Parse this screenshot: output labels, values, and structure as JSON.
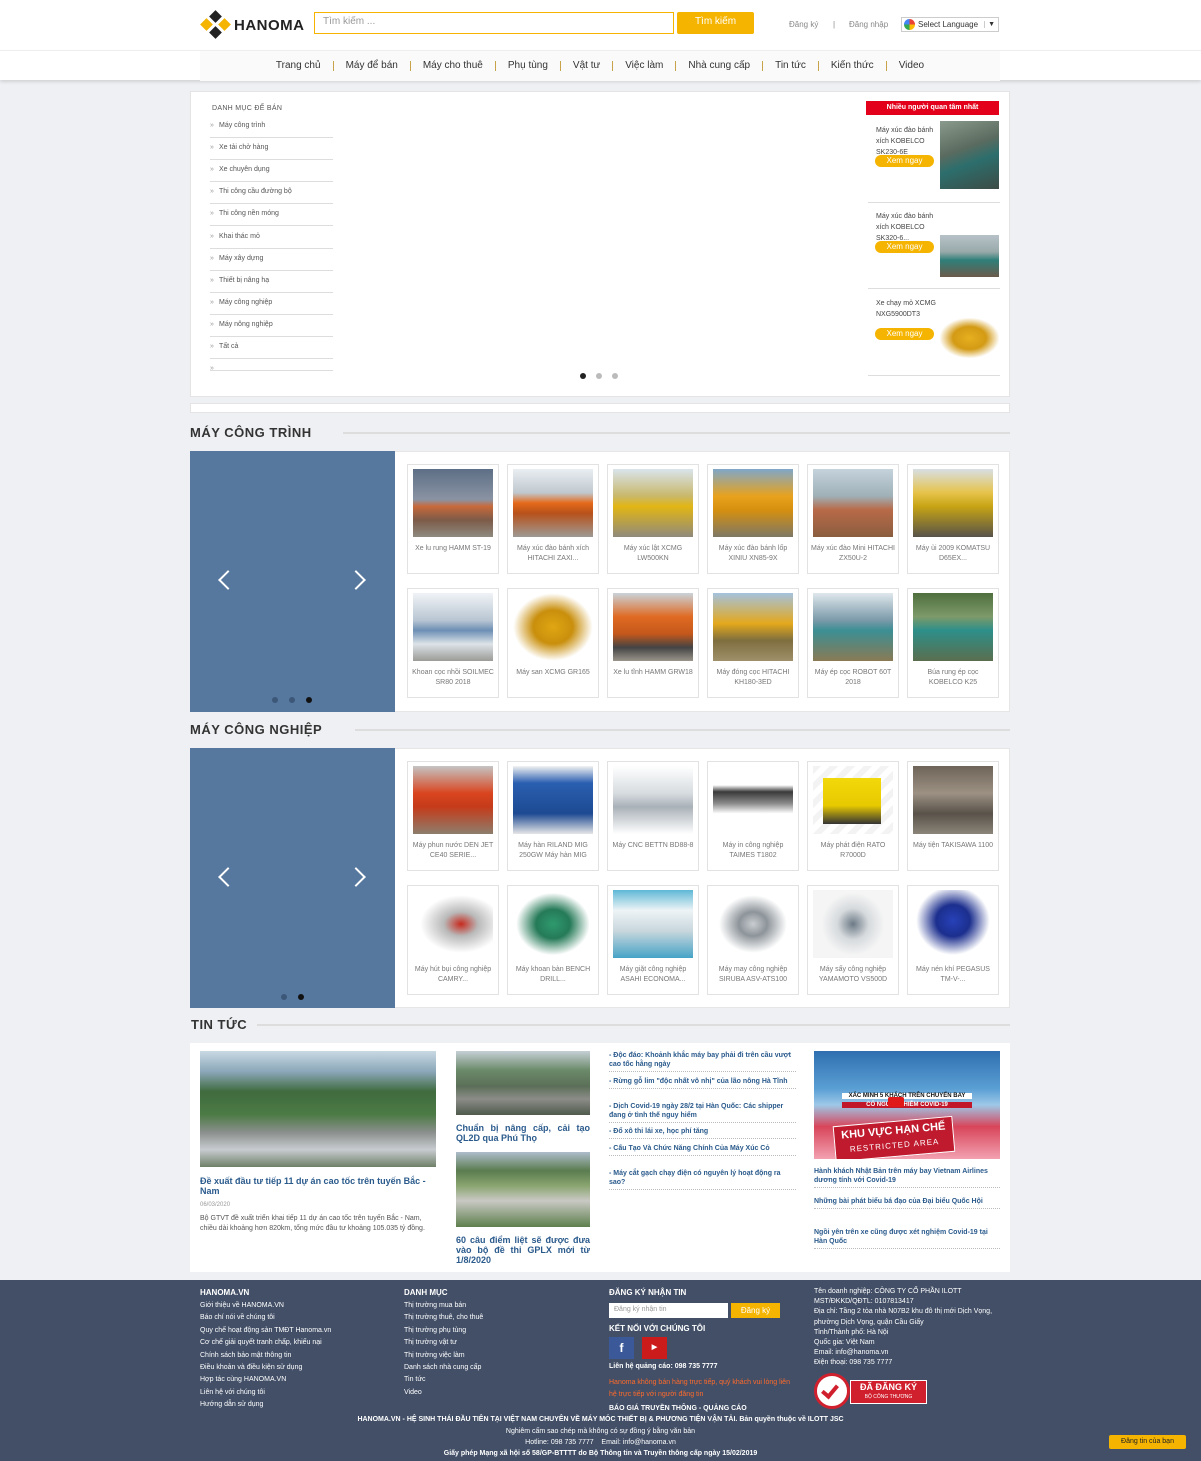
{
  "header": {
    "logo_text": "HANOMA",
    "search_placeholder": "Tìm kiếm ...",
    "search_button": "Tìm kiếm",
    "register": "Đăng ký",
    "separator": "|",
    "login": "Đăng nhập",
    "language": "Select Language",
    "language_arrow": "▼"
  },
  "nav": [
    "Trang chủ",
    "Máy để bán",
    "Máy cho thuê",
    "Phụ tùng",
    "Vật tư",
    "Việc làm",
    "Nhà cung cấp",
    "Tin tức",
    "Kiến thức",
    "Video"
  ],
  "category": {
    "heading": "DANH MỤC ĐỂ BÁN",
    "items": [
      "Máy công trình",
      "Xe tải chở hàng",
      "Xe chuyên dụng",
      "Thi công cầu đường bộ",
      "Thi công nền móng",
      "Khai thác mỏ",
      "Máy xây dựng",
      "Thiết bị nâng hạ",
      "Máy công nghiệp",
      "Máy nông nghiệp",
      "Tất cả"
    ]
  },
  "popular": {
    "heading": "Nhiều người quan tâm nhất",
    "button": "Xem ngay",
    "items": [
      {
        "title": "Máy xúc đào bánh xích KOBELCO SK230-6E"
      },
      {
        "title": "Máy xúc đào bánh xích KOBELCO SK320-6..."
      },
      {
        "title": "Xe chạy mỏ XCMG NXG5900DT3"
      }
    ]
  },
  "section_construction": {
    "title": "MÁY CÔNG TRÌNH",
    "products": [
      "Xe lu rung HAMM ST-19",
      "Máy xúc đào bánh xích HITACHI ZAXI...",
      "Máy xúc lật XCMG LW500KN",
      "Máy xúc đào bánh lốp XINIU XN85-9X",
      "Máy xúc đào Mini HITACHI ZX50U-2",
      "Máy ủi 2009 KOMATSU D65EX...",
      "Khoan cọc nhồi SOILMEC SR80 2018",
      "Máy san XCMG GR165",
      "Xe lu tĩnh HAMM GRW18",
      "Máy đóng cọc HITACHI KH180-3ED",
      "Máy ép cọc ROBOT 60T 2018",
      "Búa rung ép cọc KOBELCO K25"
    ]
  },
  "section_industrial": {
    "title": "MÁY CÔNG NGHIỆP",
    "products": [
      "Máy phun nước DEN JET CE40 SERIE...",
      "Máy hàn RILAND MIG 250GW Máy hàn MIG",
      "Máy CNC BETTN BD88-8",
      "Máy in công nghiệp TAIMES T1802",
      "Máy phát điện RATO R7000D",
      "Máy tiện TAKISAWA 1100",
      "Máy hút bụi công nghiệp CAMRY...",
      "Máy khoan bàn BENCH DRILL...",
      "Máy giặt công nghiệp ASAHI ECONOMA...",
      "Máy may công nghiệp SIRUBA ASV-ATS100",
      "Máy sấy công nghiệp YAMAMOTO VS500D",
      "Máy nén khí PEGASUS TM-V-..."
    ]
  },
  "news": {
    "title": "TIN TỨC",
    "main": {
      "headline": "Đề xuất đầu tư tiếp 11 dự án cao tốc trên tuyến Bắc - Nam",
      "date": "06/03/2020",
      "summary": "Bộ GTVT đề xuất triển khai tiếp 11 dự án cao tốc trên tuyến Bắc - Nam, chiều dài khoảng hơn 820km, tổng mức đầu tư khoảng 105.035 tỷ đồng."
    },
    "middle": [
      "Chuẩn bị nâng cấp, cải tạo QL2D qua Phú Thọ",
      "60 câu điểm liệt sẽ được đưa vào bộ đề thi GPLX mới từ 1/8/2020"
    ],
    "list": [
      "- Độc đáo: Khoảnh khắc máy bay phải đi trên cầu vượt cao tốc hằng ngày",
      "- Rừng gỗ lim \"độc nhất vô nhị\" của lão nông Hà Tĩnh",
      "- Dịch Covid-19 ngày 28/2 tại Hàn Quốc: Các shipper đang ở tình thế nguy hiểm",
      "- Đổ xô thi lái xe, học phí tăng",
      "- Cấu Tạo Và Chức Năng Chính Của Máy Xúc Cỏ",
      "- Máy cắt gạch chạy điện có nguyên lý hoạt động ra sao?"
    ],
    "video_caption_top": "XÁC MINH 5 KHÁCH TRÊN CHUYẾN BAY",
    "video_caption_mid": "CÓ NGƯỜI NHIỄM COVID-19",
    "video_sign": "KHU VỰC HẠN CHẾ",
    "video_sign_en": "RESTRICTED AREA",
    "right": [
      "Hành khách Nhật Bản trên máy bay Vietnam Airlines dương tính với Covid-19",
      "Những bài phát biểu bá đạo của Đại biểu Quốc Hội",
      "Ngồi yên trên xe cũng được xét nghiệm Covid-19 tại Hàn Quốc"
    ]
  },
  "footer": {
    "col1_title": "HANOMA.VN",
    "col1": [
      "Giới thiệu về HANOMA.VN",
      "Báo chí nói về chúng tôi",
      "Quy chế hoạt động sàn TMĐT Hanoma.vn",
      "Cơ chế giải quyết tranh chấp, khiếu nại",
      "Chính sách bảo mật thông tin",
      "Điều khoản và điều kiện sử dụng",
      "Hợp tác cùng HANOMA.VN",
      "Liên hệ với chúng tôi",
      "Hướng dẫn sử dụng"
    ],
    "col2_title": "DANH MỤC",
    "col2": [
      "Thị trường mua bán",
      "Thị trường thuê, cho thuê",
      "Thị trường phụ tùng",
      "Thị trường vật tư",
      "Thị trường việc làm",
      "Danh sách nhà cung cấp",
      "Tin tức",
      "Video"
    ],
    "newsletter_title": "ĐĂNG KÝ NHẬN TIN",
    "newsletter_placeholder": "Đăng ký nhận tin",
    "newsletter_button": "Đăng ký",
    "connect_title": "KẾT NỐI VỚI CHÚNG TÔI",
    "ad_contact": "Liên hệ quảng cáo: 098 735 7777",
    "warning": "Hanoma không bán hàng trực tiếp, quý khách vui lòng liên hệ trực tiếp với người đăng tin",
    "pricing": "BÁO GIÁ TRUYỀN THÔNG - QUẢNG CÁO",
    "company": [
      "Tên doanh nghiệp: CÔNG TY CỔ PHẦN ILOTT",
      "MST/ĐKKD/QĐTL: 0107813417",
      "Địa chỉ: Tầng 2 tòa nhà N07B2 khu đô thị mới Dịch Vọng, phường Dịch Vọng, quận Cầu Giấy",
      "Tỉnh/Thành phố: Hà Nội",
      "Quốc gia: Việt Nam",
      "Email: info@hanoma.vn",
      "Điện thoại: 098 735 7777"
    ],
    "badge_main": "ĐÃ ĐĂNG KÝ",
    "badge_sub": "BỘ CÔNG THƯƠNG",
    "bottom": [
      "HANOMA.VN - HỆ SINH THÁI ĐẦU TIÊN TẠI VIỆT NAM CHUYÊN VỀ MÁY MÓC THIẾT BỊ & PHƯƠNG TIỆN VẬN TẢI. Bản quyền thuộc về ILOTT JSC",
      "Nghiêm cấm sao chép mà không có sự đồng ý bằng văn bản",
      "Hotline: 098 735 7777    Email: info@hanoma.vn",
      "Giấy phép Mạng xã hội số 58/GP-BTTTT do Bộ Thông tin và Truyền thông cấp ngày 15/02/2019"
    ],
    "post_button": "Đăng tin của bạn"
  },
  "colors": {
    "accent": "#f5b400",
    "panel": "#56789f",
    "footer": "#424f67",
    "news_link": "#2a5a8c",
    "hot": "#e2001a"
  }
}
